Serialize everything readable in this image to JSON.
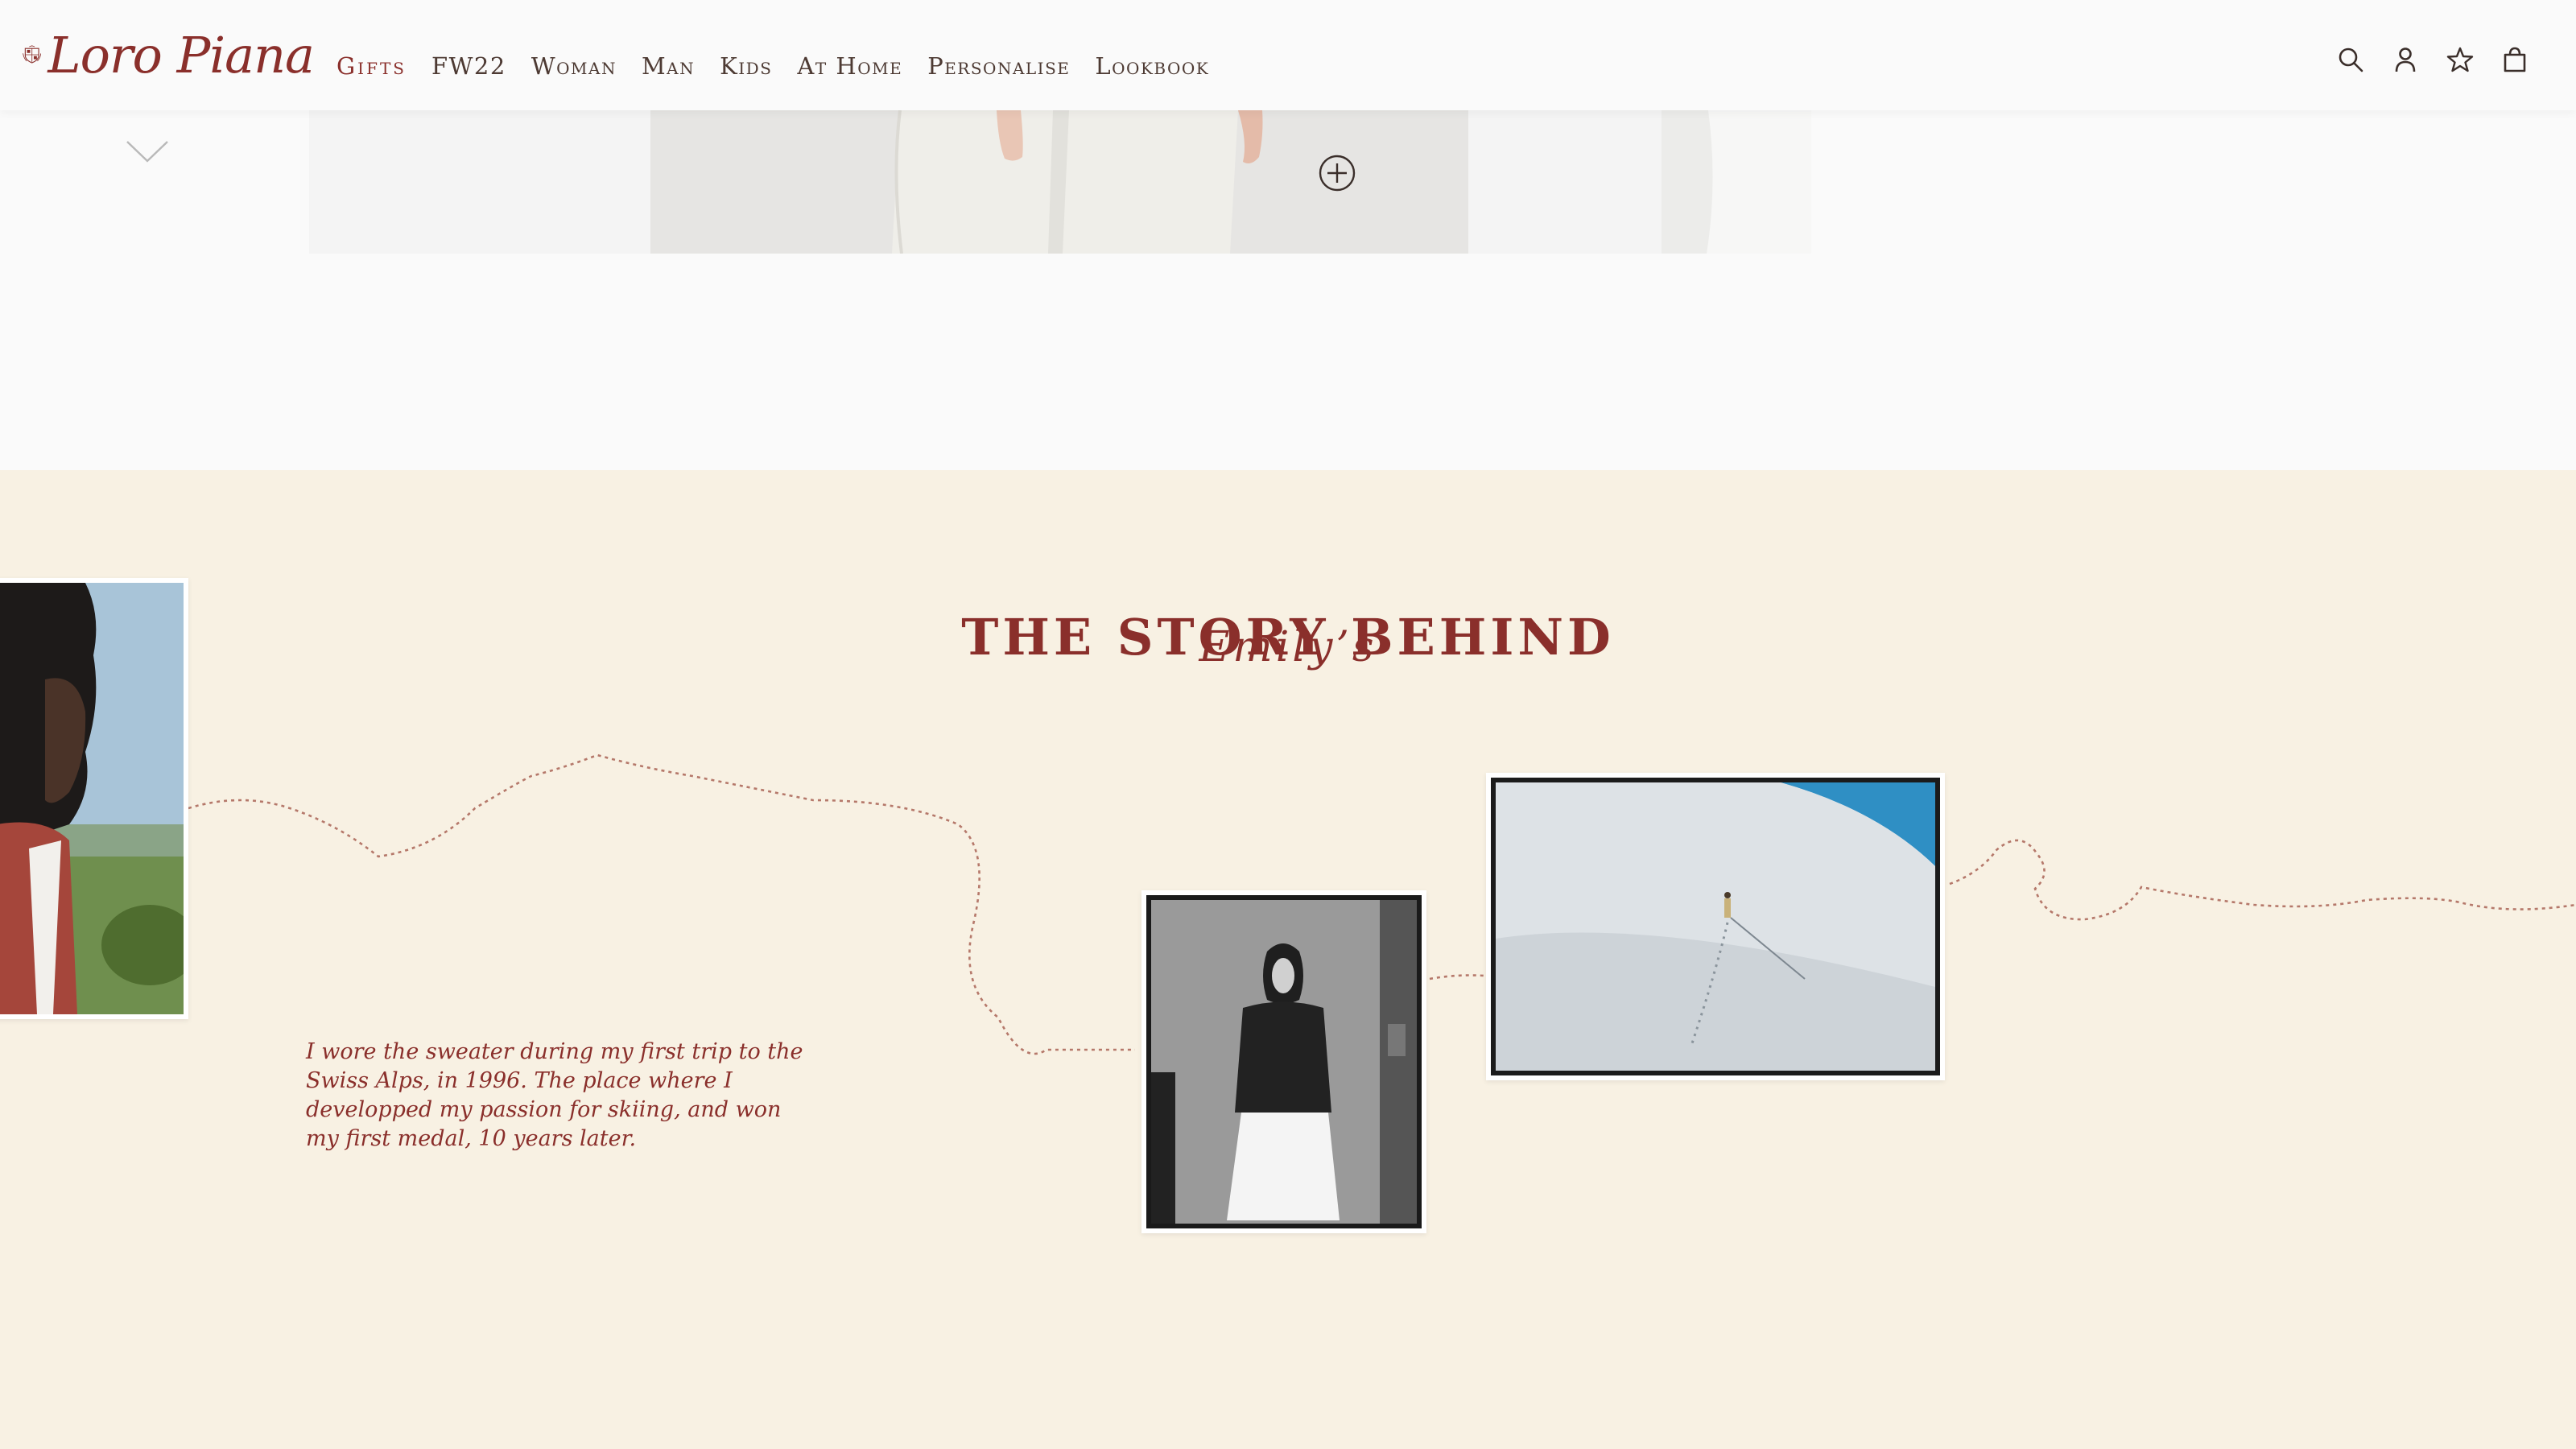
{
  "brand": {
    "name": "Loro Piana",
    "accent_color": "#8a2f2b",
    "story_background": "#f8f1e3"
  },
  "nav": {
    "items": [
      {
        "label": "Gifts",
        "active": true
      },
      {
        "label": "FW22"
      },
      {
        "label": "Woman"
      },
      {
        "label": "Man"
      },
      {
        "label": "Kids"
      },
      {
        "label": "At Home"
      },
      {
        "label": "Personalise"
      },
      {
        "label": "Lookbook"
      }
    ]
  },
  "header_icons": [
    "search-icon",
    "account-icon",
    "wishlist-star-icon",
    "shopping-bag-icon"
  ],
  "product": {
    "carousel_arrow_icon": "chevron-down-icon",
    "add_icon": "plus-circle-icon"
  },
  "story": {
    "title": "THE STORY BEHIND",
    "subtitle": "Emily’s",
    "quote": "I wore the sweater during my first trip to the Swiss Alps, in 1996. The place where I developped my passion for skiing, and won my first medal,  10 years later."
  }
}
